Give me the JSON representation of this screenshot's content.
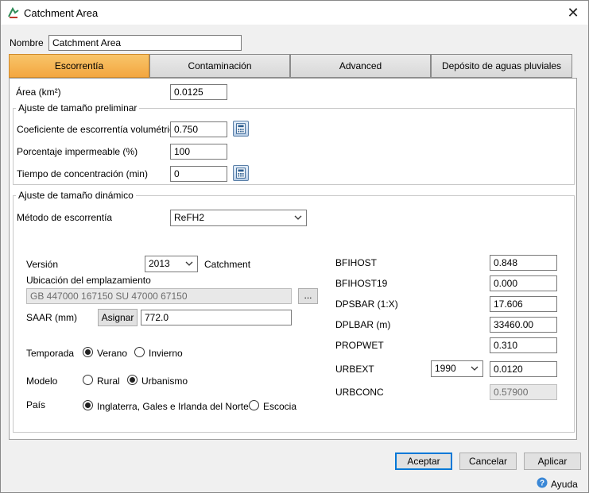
{
  "window": {
    "title": "Catchment Area",
    "close_glyph": "✕"
  },
  "nombre": {
    "label": "Nombre",
    "value": "Catchment Area"
  },
  "tabs": [
    {
      "label": "Escorrentía",
      "active": true
    },
    {
      "label": "Contaminación",
      "active": false
    },
    {
      "label": "Advanced",
      "active": false
    },
    {
      "label": "Depósito de aguas pluviales",
      "active": false
    }
  ],
  "area": {
    "label": "Área (km²)",
    "value": "0.0125"
  },
  "preliminar": {
    "title": "Ajuste de tamaño preliminar",
    "coef_label": "Coeficiente de escorrentía volumétrica",
    "coef_value": "0.750",
    "imperm_label": "Porcentaje impermeable (%)",
    "imperm_value": "100",
    "tiempo_label": "Tiempo de concentración (min)",
    "tiempo_value": "0"
  },
  "dinamico": {
    "title": "Ajuste de tamaño dinámico",
    "metodo_label": "Método de escorrentía",
    "metodo_value": "ReFH2",
    "version_label": "Versión",
    "version_value": "2013",
    "catchment_label": "Catchment",
    "ubicacion_label": "Ubicación del emplazamiento",
    "ubicacion_value": "GB 447000 167150 SU 47000 67150",
    "browse_label": "...",
    "saar_label": "SAAR (mm)",
    "asignar_label": "Asignar",
    "saar_value": "772.0",
    "temporada_label": "Temporada",
    "verano_label": "Verano",
    "invierno_label": "Invierno",
    "modelo_label": "Modelo",
    "rural_label": "Rural",
    "urbanismo_label": "Urbanismo",
    "pais_label": "País",
    "inglaterra_label": "Inglaterra, Gales e Irlanda del Norte",
    "escocia_label": "Escocia"
  },
  "params": {
    "bfihost_label": "BFIHOST",
    "bfihost_value": "0.848",
    "bfihost19_label": "BFIHOST19",
    "bfihost19_value": "0.000",
    "dpsbar_label": "DPSBAR (1:X)",
    "dpsbar_value": "17.606",
    "dplbar_label": "DPLBAR (m)",
    "dplbar_value": "33460.00",
    "propwet_label": "PROPWET",
    "propwet_value": "0.310",
    "urbext_label": "URBEXT",
    "urbext_year": "1990",
    "urbext_value": "0.0120",
    "urbconc_label": "URBCONC",
    "urbconc_value": "0.57900"
  },
  "footer": {
    "aceptar": "Aceptar",
    "cancelar": "Cancelar",
    "aplicar": "Aplicar",
    "ayuda": "Ayuda"
  },
  "colors": {
    "active_tab": "#f3a640",
    "primary_border": "#0078d7"
  }
}
